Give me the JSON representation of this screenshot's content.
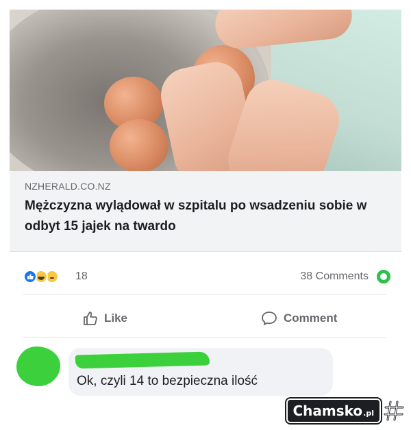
{
  "post": {
    "image_alt": "hands peeling boiled eggs over a metal pot",
    "link": {
      "domain": "NZHERALD.CO.NZ",
      "title": "Mężczyzna wylądował w szpitalu po wsadzeniu sobie w odbyt 15 jajek na twardo"
    },
    "reactions": {
      "icons": [
        "like-icon",
        "haha-icon",
        "sad-icon"
      ],
      "count": "18"
    },
    "comments_count": "38 Comments",
    "actions": {
      "like_label": "Like",
      "comment_label": "Comment"
    }
  },
  "comment": {
    "text": "Ok, czyli 14 to bezpieczna ilość",
    "redaction_color": "#3cd13c"
  },
  "watermark": {
    "text": "Chamsko",
    "suffix": ".pl"
  },
  "colors": {
    "text_primary": "#1c1e21",
    "text_secondary": "#65676b",
    "link_bg": "#f2f3f5",
    "like_blue": "#1877f2",
    "comments_badge": "#2fbf4f"
  }
}
